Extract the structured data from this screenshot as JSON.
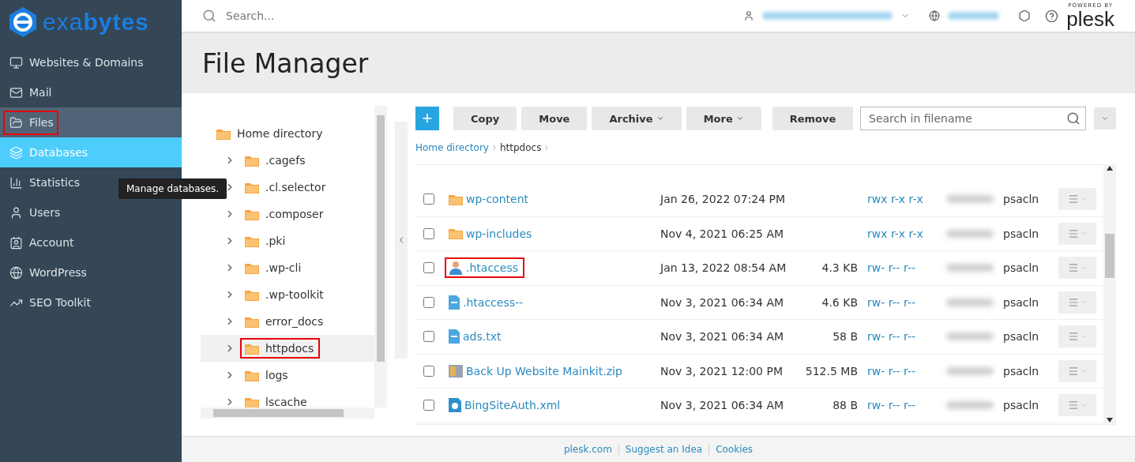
{
  "brand": {
    "name": "exa**bytes**"
  },
  "sidebar": {
    "items": [
      {
        "label": "Websites & Domains",
        "selected": false,
        "hovered": false,
        "highlighted": false
      },
      {
        "label": "Mail",
        "selected": false,
        "hovered": false,
        "highlighted": false
      },
      {
        "label": "Files",
        "selected": true,
        "hovered": false,
        "highlighted": true
      },
      {
        "label": "Databases",
        "selected": false,
        "hovered": true,
        "highlighted": false
      },
      {
        "label": "Statistics",
        "selected": false,
        "hovered": false,
        "highlighted": false
      },
      {
        "label": "Users",
        "selected": false,
        "hovered": false,
        "highlighted": false
      },
      {
        "label": "Account",
        "selected": false,
        "hovered": false,
        "highlighted": false
      },
      {
        "label": "WordPress",
        "selected": false,
        "hovered": false,
        "highlighted": false
      },
      {
        "label": "SEO Toolkit",
        "selected": false,
        "hovered": false,
        "highlighted": false
      }
    ]
  },
  "tooltip": "Manage databases.",
  "topbar": {
    "search_placeholder": "Search...",
    "powered_by": "POWERED BY",
    "product": "plesk"
  },
  "page_title": "File Manager",
  "tree": {
    "label": "Home directory",
    "children": [
      {
        "label": ".cagefs",
        "selected": false,
        "highlighted": false
      },
      {
        "label": ".cl.selector",
        "selected": false,
        "highlighted": false
      },
      {
        "label": ".composer",
        "selected": false,
        "highlighted": false
      },
      {
        "label": ".pki",
        "selected": false,
        "highlighted": false
      },
      {
        "label": ".wp-cli",
        "selected": false,
        "highlighted": false
      },
      {
        "label": ".wp-toolkit",
        "selected": false,
        "highlighted": false
      },
      {
        "label": "error_docs",
        "selected": false,
        "highlighted": false
      },
      {
        "label": "httpdocs",
        "selected": true,
        "highlighted": true
      },
      {
        "label": "logs",
        "selected": false,
        "highlighted": false
      },
      {
        "label": "lscache",
        "selected": false,
        "highlighted": false
      }
    ]
  },
  "toolbar": {
    "add": "+",
    "buttons": [
      {
        "label": "Copy",
        "dropdown": false
      },
      {
        "label": "Move",
        "dropdown": false
      },
      {
        "label": "Archive",
        "dropdown": true
      },
      {
        "label": "More",
        "dropdown": true
      },
      {
        "label": "Remove",
        "dropdown": false
      }
    ],
    "search_placeholder": "Search in filename"
  },
  "breadcrumbs": [
    "Home directory",
    "httpdocs"
  ],
  "files": [
    {
      "name": "wp-content",
      "kind": "folder",
      "modified": "Jan 26, 2022 07:24 PM",
      "permissions": "rwx r-x r-x",
      "group": "psacln",
      "checked": false,
      "highlighted": false
    },
    {
      "name": "wp-includes",
      "kind": "folder",
      "modified": "Nov 4, 2021 06:25 AM",
      "permissions": "rwx r-x r-x",
      "group": "psacln",
      "checked": false,
      "highlighted": false
    },
    {
      "name": ".htaccess",
      "kind": "user",
      "modified": "Jan 13, 2022 08:54 AM",
      "size": "4.3 KB",
      "permissions": "rw- r-- r--",
      "group": "psacln",
      "checked": false,
      "highlighted": true
    },
    {
      "name": ".htaccess--",
      "kind": "document",
      "modified": "Nov 3, 2021 06:34 AM",
      "size": "4.6 KB",
      "permissions": "rw- r-- r--",
      "group": "psacln",
      "checked": false,
      "highlighted": false
    },
    {
      "name": "ads.txt",
      "kind": "document",
      "modified": "Nov 3, 2021 06:34 AM",
      "size": "58 B",
      "permissions": "rw- r-- r--",
      "group": "psacln",
      "checked": false,
      "highlighted": false
    },
    {
      "name": "Back Up Website Mainkit.zip",
      "kind": "archive",
      "modified": "Nov 3, 2021 12:00 PM",
      "size": "512.5 MB",
      "permissions": "rw- r-- r--",
      "group": "psacln",
      "checked": false,
      "highlighted": false
    },
    {
      "name": "BingSiteAuth.xml",
      "kind": "web",
      "modified": "Nov 3, 2021 06:34 AM",
      "size": "88 B",
      "permissions": "rw- r-- r--",
      "group": "psacln",
      "checked": false,
      "highlighted": false
    }
  ],
  "footer": [
    "plesk.com",
    "Suggest an Idea",
    "Cookies"
  ]
}
